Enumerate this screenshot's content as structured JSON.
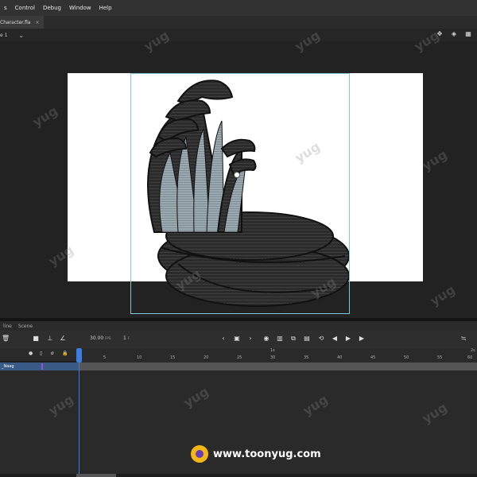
{
  "menu": {
    "items": [
      "s",
      "Control",
      "Debug",
      "Window",
      "Help"
    ]
  },
  "document_tab": {
    "filename": "Character.fla",
    "close": "×"
  },
  "scene_bar": {
    "scene_label": "e 1",
    "chevron": "⌄"
  },
  "panel_tabs": [
    "line",
    "Scene"
  ],
  "timeline": {
    "fps_value": "30.00",
    "fps_unit": "FPS",
    "frame_value": "1",
    "frame_unit": "F",
    "ruler_top_label": "1s",
    "ruler_top_label2": "2s",
    "ruler_ticks": [
      "5",
      "10",
      "15",
      "20",
      "25",
      "30",
      "35",
      "40",
      "45",
      "50",
      "55",
      "60"
    ],
    "layer_name": "_Naag",
    "playhead_frame": "1"
  },
  "watermark": {
    "text": "yug"
  },
  "brand": {
    "url": "www.toonyug.com"
  },
  "colors": {
    "ui_dark": "#1e1e1e",
    "panel": "#2a2a2a",
    "accent_blue": "#3b7de0",
    "selection_box": "#7ecbd6",
    "snake_dark": "#2a2a2a",
    "snake_belly": "#9aa8b0",
    "brand_yellow": "#f2b617"
  },
  "icons": [
    "trash-icon",
    "camera-icon",
    "layer-parent-icon",
    "onion-skin-icon",
    "prev-frame-icon",
    "next-frame-icon",
    "play-icon",
    "loop-icon"
  ]
}
